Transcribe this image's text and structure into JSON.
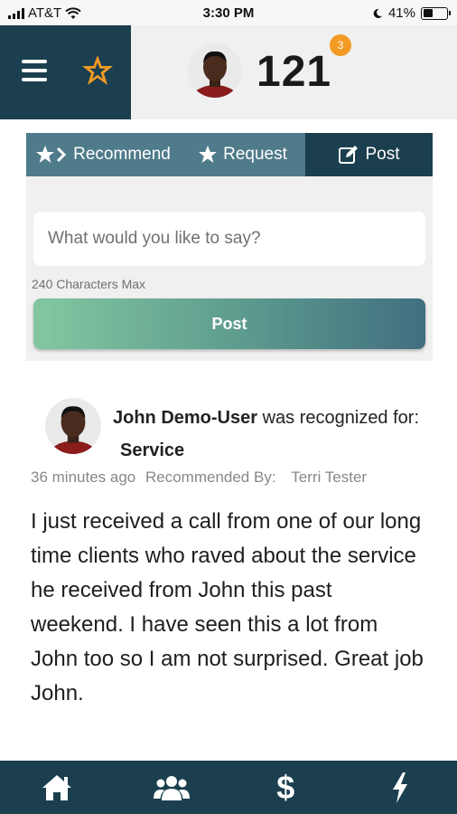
{
  "status_bar": {
    "carrier": "AT&T",
    "time": "3:30 PM",
    "battery": "41%",
    "battery_level": 0.41
  },
  "header": {
    "score": "121",
    "notification_count": "3"
  },
  "tabs": [
    {
      "label": "Recommend",
      "icon": "star-chevron-icon"
    },
    {
      "label": "Request",
      "icon": "star-icon"
    },
    {
      "label": "Post",
      "icon": "edit-icon"
    }
  ],
  "compose": {
    "placeholder": "What would you like to say?",
    "char_limit_text": "240 Characters Max",
    "post_label": "Post"
  },
  "feed": [
    {
      "name": "John Demo-User",
      "action_text": "was recognized for:",
      "category": "Service",
      "time_ago": "36 minutes ago",
      "recommended_by_label": "Recommended By:",
      "recommender": "Terri Tester",
      "body": "I just received a call from one of our long time clients who raved about the service he received from John this past weekend. I have seen this a lot from John too so I am not surprised. Great job John."
    }
  ],
  "bottom_nav": {
    "items": [
      "home-icon",
      "team-icon",
      "dollar-icon",
      "lightning-icon"
    ],
    "dollar_glyph": "$"
  },
  "colors": {
    "primary_dark": "#1b3f4e",
    "tab_inactive": "#4f7b8a",
    "badge": "#f29a24",
    "post_gradient_start": "#83c7a1",
    "post_gradient_end": "#416f80"
  }
}
